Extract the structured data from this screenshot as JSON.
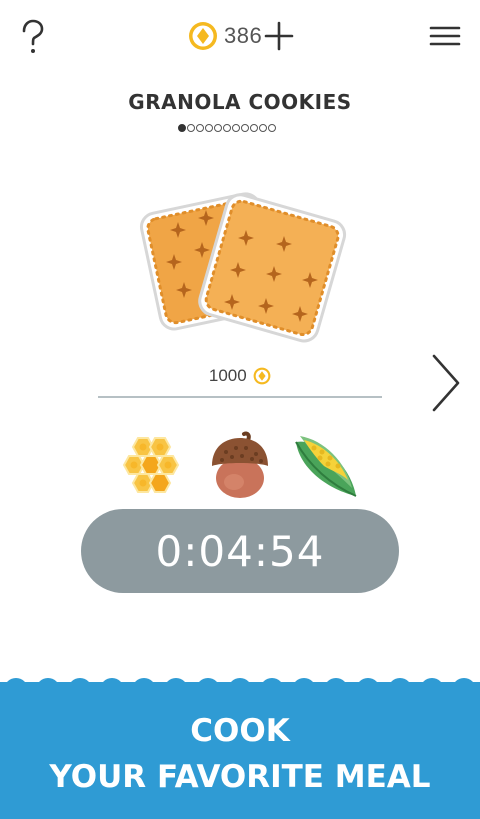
{
  "header": {
    "help_icon": "question-mark-icon",
    "coin_icon": "coin-icon",
    "coin_count": "386",
    "add_icon": "plus-icon",
    "menu_icon": "hamburger-menu-icon"
  },
  "recipe": {
    "title": "GRANOLA COOKIES",
    "page_count": 11,
    "active_page": 1,
    "image_icon": "granola-cookies-icon",
    "price": "1000",
    "price_icon": "coin-icon",
    "next_icon": "chevron-right-icon"
  },
  "ingredients": [
    {
      "name": "honeycomb",
      "icon": "honeycomb-icon"
    },
    {
      "name": "acorn",
      "icon": "acorn-icon"
    },
    {
      "name": "corn",
      "icon": "corn-icon"
    }
  ],
  "timer": {
    "value": "0:04:54"
  },
  "banner": {
    "line1": "COOK",
    "line2": "YOUR FAVORITE MEAL"
  },
  "colors": {
    "accent_blue": "#2f9bd4",
    "timer_gray": "#8d9a9f",
    "coin_gold": "#f5b920",
    "cookie_orange": "#f0a546"
  }
}
